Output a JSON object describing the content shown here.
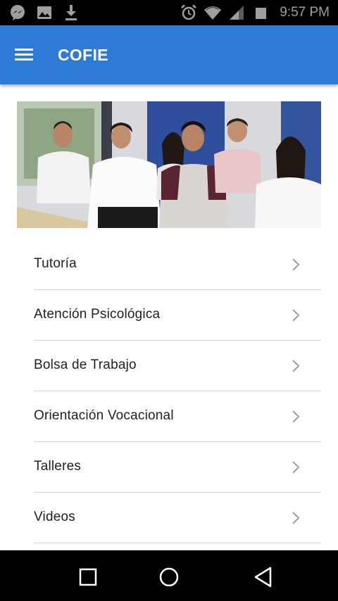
{
  "status_bar": {
    "time": "9:57 PM",
    "left_icons": [
      "messenger-icon",
      "image-icon",
      "download-icon"
    ],
    "right_icons": [
      "alarm-icon",
      "wifi-icon",
      "signal-icon",
      "battery-icon"
    ]
  },
  "app_bar": {
    "title": "COFIE",
    "menu_icon": "hamburger-menu-icon",
    "color": "#2e7bd6"
  },
  "hero_image": {
    "subject": "group-of-students-photo"
  },
  "menu": {
    "items": [
      {
        "label": "Tutoría"
      },
      {
        "label": "Atención Psicológica"
      },
      {
        "label": "Bolsa de Trabajo"
      },
      {
        "label": "Orientación Vocacional"
      },
      {
        "label": "Talleres"
      },
      {
        "label": "Videos"
      }
    ],
    "chevron_icon": "chevron-right-icon"
  },
  "nav_bar": {
    "buttons": [
      "recents-square-icon",
      "home-circle-icon",
      "back-triangle-icon"
    ]
  }
}
